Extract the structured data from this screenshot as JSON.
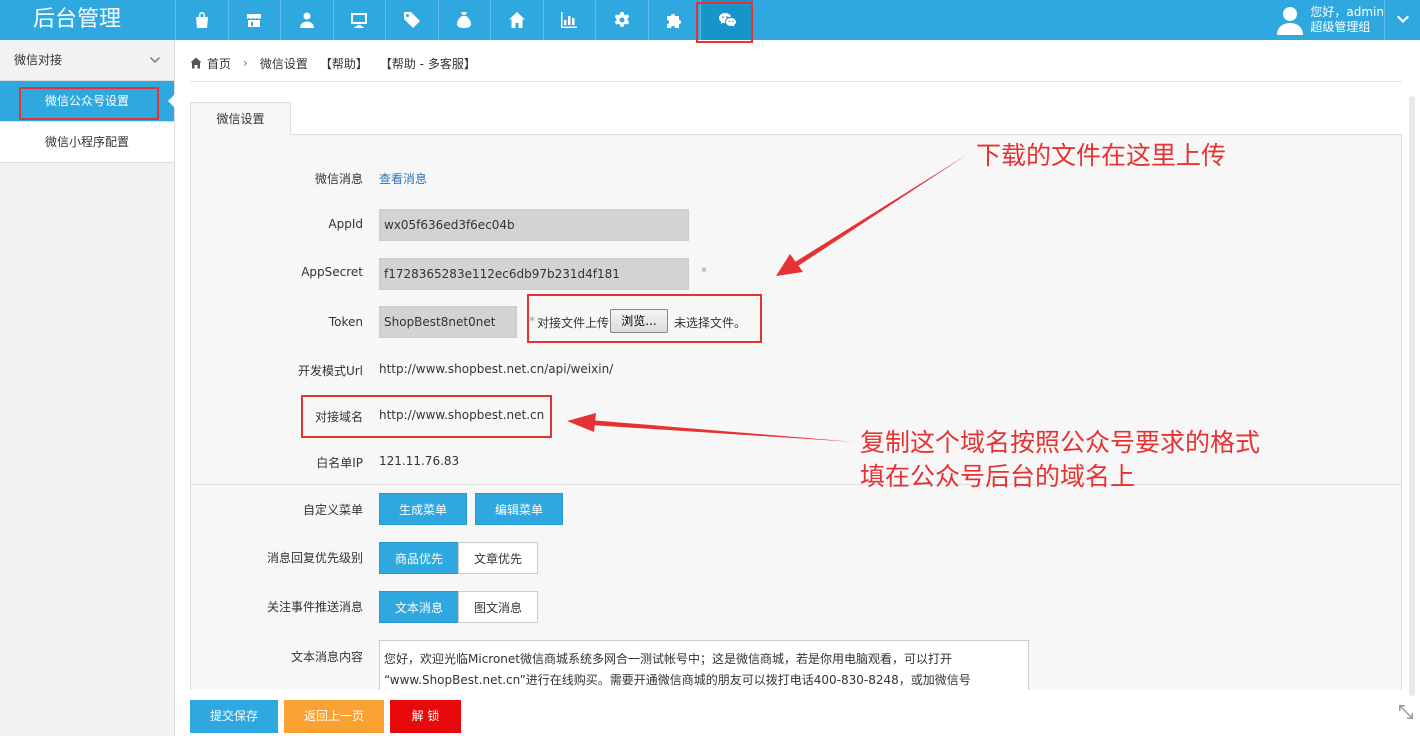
{
  "header": {
    "brand": "后台管理",
    "nav_icons": [
      "bag-icon",
      "store-icon",
      "user-icon",
      "monitor-icon",
      "tag-icon",
      "money-bag-icon",
      "home-icon",
      "bar-chart-icon",
      "gear-icon",
      "puzzle-icon",
      "wechat-icon"
    ],
    "active_nav": "wechat-icon",
    "greeting": "您好，admin",
    "role": "超级管理组"
  },
  "sidebar": {
    "group": "微信对接",
    "items": [
      {
        "label": "微信公众号设置",
        "active": true
      },
      {
        "label": "微信小程序配置",
        "active": false
      }
    ]
  },
  "breadcrumb": [
    "首页",
    "微信设置",
    "【帮助】",
    "【帮助 - 多客服】"
  ],
  "tab": "微信设置",
  "form": {
    "message_label": "微信消息",
    "message_link": "查看消息",
    "appid_label": "AppId",
    "appid_value": "wx05f636ed3f6ec04b",
    "appsecret_label": "AppSecret",
    "appsecret_value": "f1728365283e112ec6db97b231d4f181",
    "token_label": "Token",
    "token_value": "ShopBest8net0net",
    "required_mark": "*",
    "upload_label": "对接文件上传",
    "browse_button": "浏览...",
    "no_file": "未选择文件。",
    "devurl_label": "开发模式Url",
    "devurl_value": "http://www.shopbest.net.cn/api/weixin/",
    "domain_label": "对接域名",
    "domain_value": "http://www.shopbest.net.cn",
    "whitelist_label": "白名单IP",
    "whitelist_value": "121.11.76.83",
    "menu_label": "自定义菜单",
    "menu_generate": "生成菜单",
    "menu_edit": "编辑菜单",
    "priority_label": "消息回复优先级别",
    "priority_options": [
      "商品优先",
      "文章优先"
    ],
    "follow_label": "关注事件推送消息",
    "follow_options": [
      "文本消息",
      "图文消息"
    ],
    "text_label": "文本消息内容",
    "text_value_line1": "您好，欢迎光临Micronet微信商城系统多网合一测试帐号中；这是微信商城，若是你用电脑观看，可以打开",
    "text_value_line2": "“www.ShopBest.net.cn”进行在线购买。需要开通微信商城的朋友可以拨打电话400-830-8248，或加微信号"
  },
  "footer": {
    "save": "提交保存",
    "back": "返回上一页",
    "unlock": "解 锁"
  },
  "annotations": {
    "upload_note": "下载的文件在这里上传",
    "domain_note_line1": "复制这个域名按照公众号要求的格式",
    "domain_note_line2": "填在公众号后台的域名上"
  },
  "colors": {
    "primary": "#2ea8de",
    "orange": "#f9a233",
    "red": "#e80a0a",
    "annotation": "#e53333"
  }
}
